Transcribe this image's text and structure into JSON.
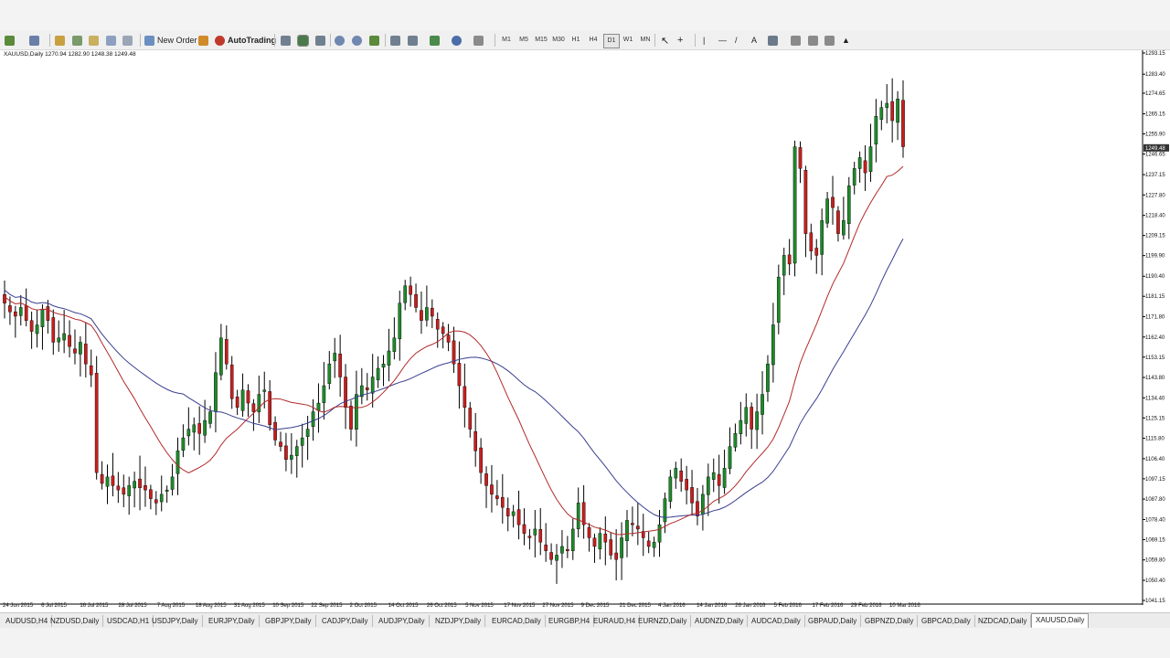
{
  "toolbar": {
    "new_order_label": "New Order",
    "autotrading_label": "AutoTrading",
    "timeframes": [
      "M1",
      "M5",
      "M15",
      "M30",
      "H1",
      "H4",
      "D1",
      "W1",
      "MN"
    ],
    "active_timeframe": "D1"
  },
  "chart": {
    "title": "XAUUSD,Daily",
    "ohlc": "1270.94 1282.90 1248.38 1249.48",
    "current_price": "1249.48",
    "colors": {
      "bull": "#1d8a2a",
      "bear": "#c81e1e",
      "ma_fast": "#b22a2a",
      "ma_slow": "#3a3f8f",
      "grid": "#e6e6e6"
    }
  },
  "chart_data": {
    "type": "candlestick",
    "y_ticks": [
      "1293.15",
      "1283.40",
      "1274.65",
      "1265.15",
      "1255.90",
      "1246.65",
      "1237.15",
      "1227.80",
      "1218.40",
      "1209.15",
      "1199.90",
      "1190.40",
      "1181.15",
      "1171.80",
      "1162.40",
      "1153.15",
      "1143.80",
      "1134.40",
      "1125.15",
      "1115.80",
      "1106.40",
      "1097.15",
      "1087.80",
      "1078.40",
      "1069.15",
      "1059.80",
      "1050.40",
      "1041.15"
    ],
    "x_labels": [
      "24 Jun 2015",
      "6 Jul 2015",
      "16 Jul 2015",
      "28 Jul 2015",
      "7 Aug 2015",
      "18 Aug 2015",
      "31 Aug 2015",
      "10 Sep 2015",
      "22 Sep 2015",
      "2 Oct 2015",
      "14 Oct 2015",
      "26 Oct 2015",
      "5 Nov 2015",
      "17 Nov 2015",
      "27 Nov 2015",
      "9 Dec 2015",
      "21 Dec 2015",
      "4 Jan 2016",
      "14 Jan 2016",
      "26 Jan 2016",
      "5 Feb 2016",
      "17 Feb 2016",
      "29 Feb 2016",
      "10 Mar 2016"
    ],
    "ylim": [
      1041.15,
      1293.15
    ],
    "series": [
      {
        "closes": [
          1178,
          1174,
          1172,
          1176,
          1170,
          1165,
          1168,
          1175,
          1170,
          1160,
          1162,
          1164,
          1158,
          1155,
          1160,
          1150,
          1145,
          1100,
          1095,
          1098,
          1094,
          1092,
          1090,
          1094,
          1096,
          1093,
          1092,
          1088,
          1086,
          1090,
          1092,
          1098,
          1110,
          1116,
          1120,
          1122,
          1118,
          1124,
          1128,
          1146,
          1162,
          1150,
          1134,
          1130,
          1138,
          1132,
          1128,
          1136,
          1138,
          1122,
          1115,
          1112,
          1106,
          1108,
          1112,
          1116,
          1120,
          1128,
          1132,
          1140,
          1150,
          1155,
          1144,
          1130,
          1120,
          1136,
          1140,
          1138,
          1144,
          1148,
          1150,
          1156,
          1162,
          1178,
          1186,
          1182,
          1176,
          1170,
          1176,
          1172,
          1166,
          1164,
          1160,
          1150,
          1140,
          1130,
          1120,
          1110,
          1100,
          1094,
          1090,
          1088,
          1084,
          1080,
          1082,
          1076,
          1072,
          1070,
          1074,
          1068,
          1064,
          1060,
          1062,
          1066,
          1064,
          1074,
          1086,
          1076,
          1070,
          1066,
          1072,
          1068,
          1062,
          1060,
          1070,
          1078,
          1076,
          1074,
          1070,
          1066,
          1068,
          1076,
          1088,
          1098,
          1102,
          1096,
          1092,
          1086,
          1080,
          1090,
          1098,
          1100,
          1094,
          1102,
          1112,
          1118,
          1124,
          1130,
          1120,
          1128,
          1136,
          1150,
          1168,
          1190,
          1200,
          1196,
          1250,
          1240,
          1210,
          1202,
          1200,
          1216,
          1226,
          1222,
          1210,
          1216,
          1232,
          1240,
          1245,
          1238,
          1250,
          1264,
          1268,
          1270,
          1262,
          1272,
          1250
        ]
      }
    ]
  },
  "tabs": [
    "AUDUSD,H4",
    "NZDUSD,Daily",
    "USDCAD,H1",
    "USDJPY,Daily",
    "EURJPY,Daily",
    "GBPJPY,Daily",
    "CADJPY,Daily",
    "AUDJPY,Daily",
    "NZDJPY,Daily",
    "EURCAD,Daily",
    "EURGBP,H4",
    "EURAUD,H4",
    "EURNZD,Daily",
    "AUDNZD,Daily",
    "AUDCAD,Daily",
    "GBPAUD,Daily",
    "GBPNZD,Daily",
    "GBPCAD,Daily",
    "NZDCAD,Daily",
    "XAUUSD,Daily"
  ],
  "active_tab": "XAUUSD,Daily"
}
